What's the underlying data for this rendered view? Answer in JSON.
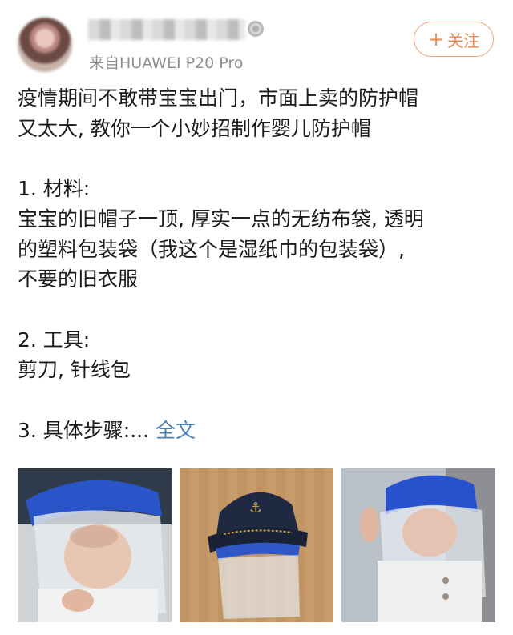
{
  "header": {
    "source": "来自HUAWEI P20 Pro",
    "follow_label": "关注",
    "icons": {
      "avatar": "user-avatar",
      "medal": "medal-icon",
      "follow": "plus-icon"
    }
  },
  "post": {
    "lines": [
      "疫情期间不敢带宝宝出门，市面上卖的防护帽",
      "又太大, 教你一个小妙招制作婴儿防护帽",
      "",
      "1. 材料:",
      "宝宝的旧帽子一顶, 厚实一点的无纺布袋, 透明",
      "的塑料包装袋（我这个是湿纸巾的包装袋）,",
      "不要的旧衣服",
      "",
      "2. 工具:",
      "剪刀, 针线包",
      "",
      "3. 具体步骤:..."
    ],
    "more_link": "全文"
  },
  "photos": [
    {
      "name": "photo-baby-blue-hat-front"
    },
    {
      "name": "photo-navy-anchor-cap"
    },
    {
      "name": "photo-baby-blue-hat-side"
    }
  ],
  "colors": {
    "accent": "#f08a4c",
    "link": "#4a7fb9",
    "meta": "#8e8e8e"
  }
}
